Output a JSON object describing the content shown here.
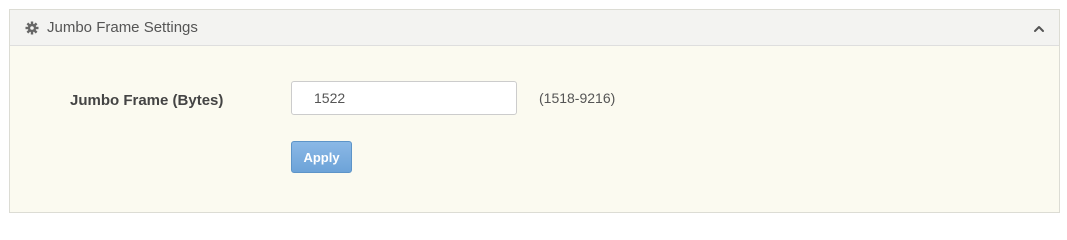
{
  "panel": {
    "title": "Jumbo Frame Settings",
    "header_icon": "gear-icon",
    "collapse_icon": "chevron-up-icon"
  },
  "form": {
    "jumbo_frame": {
      "label": "Jumbo Frame (Bytes)",
      "value": "1522",
      "range_hint": "(1518-9216)"
    },
    "apply_label": "Apply"
  },
  "colors": {
    "panel_background": "#fbfaf0",
    "header_background": "#f3f3f1",
    "apply_button": "#7aaee0"
  }
}
